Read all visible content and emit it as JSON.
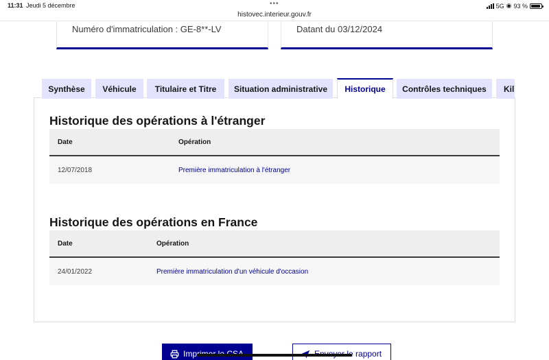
{
  "status_bar": {
    "time": "11:31",
    "date": "Jeudi 5 décembre",
    "url": "histovec.interieur.gouv.fr",
    "network": "5G",
    "battery": "93 %",
    "battery_level": 0.93
  },
  "info_cards": {
    "registration": "Numéro d'immatriculation : GE-8**-LV",
    "date": "Datant du 03/12/2024"
  },
  "tabs": [
    {
      "label": "Synthèse"
    },
    {
      "label": "Véhicule"
    },
    {
      "label": "Titulaire et Titre"
    },
    {
      "label": "Situation administrative"
    },
    {
      "label": "Historique"
    },
    {
      "label": "Contrôles techniques"
    },
    {
      "label": "Kil"
    }
  ],
  "active_tab": "Historique",
  "foreign_history": {
    "title": "Historique des opérations à l'étranger",
    "columns": [
      "Date",
      "Opération"
    ],
    "rows": [
      {
        "date": "12/07/2018",
        "operation": "Première immatriculation à l'étranger"
      }
    ]
  },
  "france_history": {
    "title": "Historique des opérations en France",
    "columns": [
      "Date",
      "Opération"
    ],
    "rows": [
      {
        "date": "24/01/2022",
        "operation": "Première immatriculation d'un véhicule d'occasion"
      }
    ]
  },
  "actions": {
    "print_label": "Imprimer le CSA",
    "send_label": "Envoyer le rapport"
  },
  "colors": {
    "primary": "#000091",
    "tab_bg": "#e3e3fd",
    "table_header_bg": "#eeeeee",
    "table_row_bg": "#f6f6f6"
  }
}
